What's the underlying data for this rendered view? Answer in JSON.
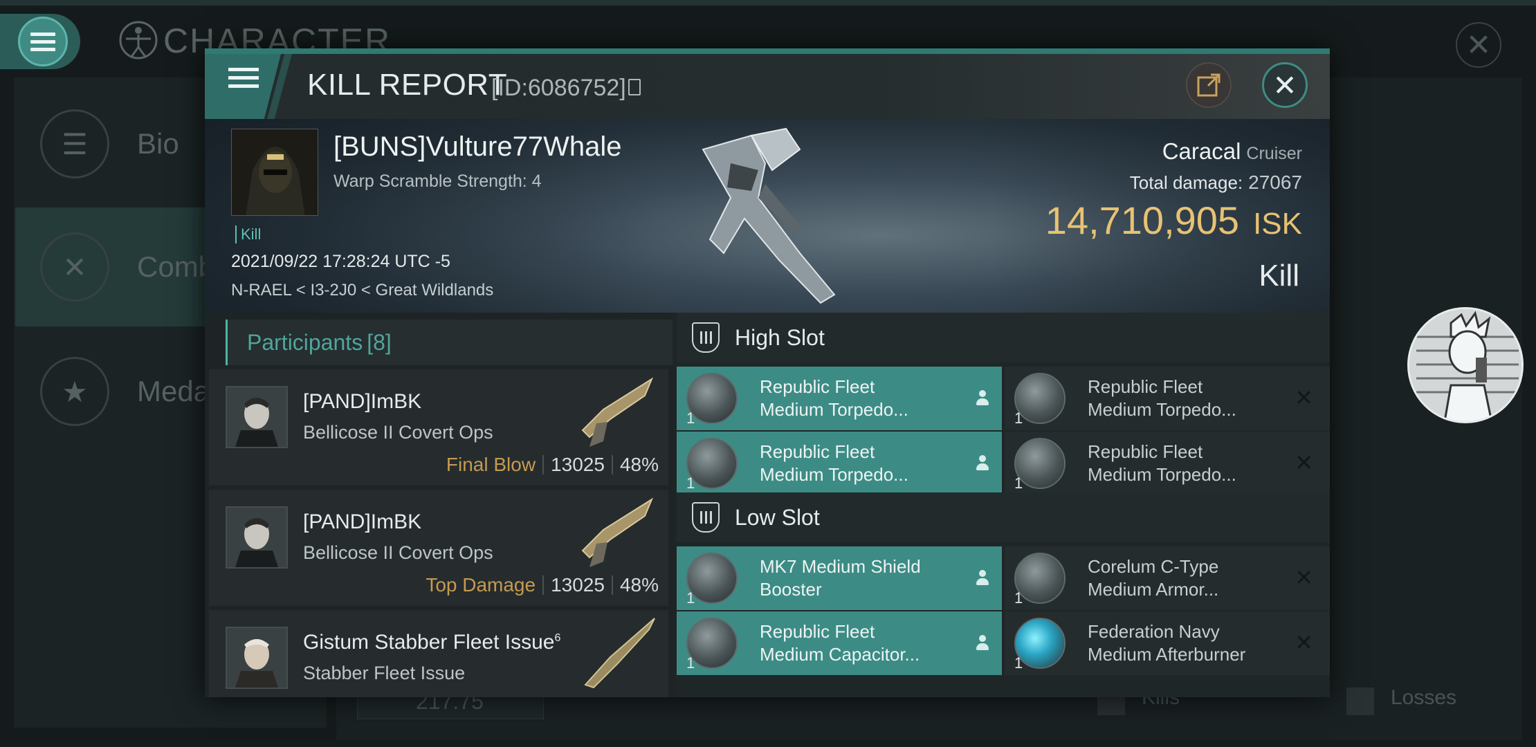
{
  "background": {
    "screen_title": "CHARACTER",
    "sidebar": [
      {
        "label": "Bio",
        "icon": "list-icon"
      },
      {
        "label": "Comb",
        "icon": "crossed-swords-icon"
      },
      {
        "label": "Medal",
        "icon": "star-badge-icon"
      }
    ],
    "bottom_value": "217.75",
    "bottom_kills": "Kills",
    "bottom_losses": "Losses"
  },
  "modal": {
    "title": "KILL REPORT",
    "id": "[ID:6086752]"
  },
  "victim": {
    "name": "[BUNS]Vulture77Whale",
    "subtitle": "Warp Scramble Strength: 4",
    "tag": "Kill",
    "datetime": "2021/09/22 17:28:24 UTC -5",
    "location": "N-RAEL < I3-2J0 < Great Wildlands",
    "ship": "Caracal",
    "ship_class": "Cruiser",
    "total_damage_label": "Total damage:",
    "total_damage": "27067",
    "isk_value": "14,710,905",
    "isk_unit": "ISK",
    "result": "Kill"
  },
  "participants": {
    "label": "Participants",
    "count": "[8]",
    "rows": [
      {
        "name": "[PAND]ImBK",
        "ship": "Bellicose II Covert Ops",
        "role": "Final Blow",
        "damage": "13025",
        "percent": "48%"
      },
      {
        "name": "[PAND]ImBK",
        "ship": "Bellicose II Covert Ops",
        "role": "Top Damage",
        "damage": "13025",
        "percent": "48%"
      },
      {
        "name": "Gistum Stabber Fleet Issue",
        "sup": "6",
        "ship": "Stabber Fleet Issue",
        "role": "",
        "damage": "",
        "percent": ""
      }
    ]
  },
  "slots": {
    "high": {
      "label": "High Slot",
      "modules": [
        {
          "line1": "Republic Fleet",
          "line2": "Medium Torpedo...",
          "qty": "1",
          "state": "fitted"
        },
        {
          "line1": "Republic Fleet",
          "line2": "Medium Torpedo...",
          "qty": "1",
          "state": "destroyed"
        },
        {
          "line1": "Republic Fleet",
          "line2": "Medium Torpedo...",
          "qty": "1",
          "state": "fitted"
        },
        {
          "line1": "Republic Fleet",
          "line2": "Medium Torpedo...",
          "qty": "1",
          "state": "destroyed"
        }
      ]
    },
    "low": {
      "label": "Low Slot",
      "modules": [
        {
          "line1": "MK7 Medium Shield",
          "line2": "Booster",
          "qty": "1",
          "state": "fitted"
        },
        {
          "line1": "Corelum C-Type",
          "line2": "Medium Armor...",
          "qty": "1",
          "state": "destroyed"
        },
        {
          "line1": "Republic Fleet",
          "line2": "Medium Capacitor...",
          "qty": "1",
          "state": "fitted"
        },
        {
          "line1": "Federation Navy",
          "line2": "Medium Afterburner",
          "qty": "1",
          "state": "destroyed"
        }
      ]
    }
  },
  "colors": {
    "accent": "#3c8c85",
    "isk": "#e8c273",
    "role": "#c59a52"
  }
}
